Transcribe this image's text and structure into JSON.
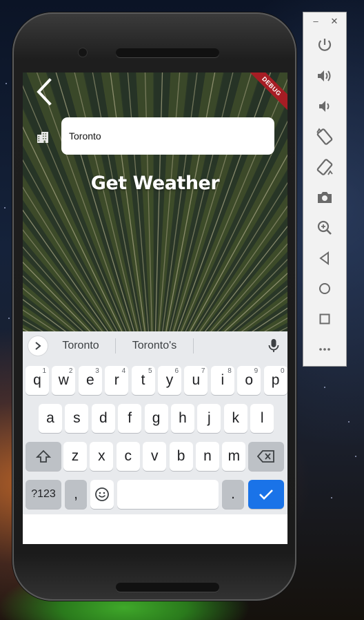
{
  "window": {
    "minimize_icon": "minimize-icon",
    "close_icon": "close-icon"
  },
  "app": {
    "debug_banner": "DEBUG",
    "city_input": {
      "value": "Toronto",
      "placeholder": ""
    },
    "get_weather_label": "Get Weather",
    "icons": {
      "back": "back-arrow-icon",
      "city": "city-buildings-icon"
    }
  },
  "keyboard": {
    "suggestions": [
      "Toronto",
      "Toronto's"
    ],
    "row1": [
      {
        "k": "q",
        "n": "1"
      },
      {
        "k": "w",
        "n": "2"
      },
      {
        "k": "e",
        "n": "3"
      },
      {
        "k": "r",
        "n": "4"
      },
      {
        "k": "t",
        "n": "5"
      },
      {
        "k": "y",
        "n": "6"
      },
      {
        "k": "u",
        "n": "7"
      },
      {
        "k": "i",
        "n": "8"
      },
      {
        "k": "o",
        "n": "9"
      },
      {
        "k": "p",
        "n": "0"
      }
    ],
    "row2": [
      "a",
      "s",
      "d",
      "f",
      "g",
      "h",
      "j",
      "k",
      "l"
    ],
    "row3": [
      "z",
      "x",
      "c",
      "v",
      "b",
      "n",
      "m"
    ],
    "symbols_label": "?123",
    "comma_label": ",",
    "period_label": "."
  },
  "emulator_toolbar": {
    "buttons": [
      "power-icon",
      "volume-up-icon",
      "volume-down-icon",
      "rotate-left-icon",
      "rotate-right-icon",
      "screenshot-icon",
      "zoom-icon",
      "back-icon",
      "home-icon",
      "overview-icon",
      "more-icon"
    ]
  },
  "colors": {
    "accent": "#1a73e8",
    "debug": "#a61d24"
  }
}
